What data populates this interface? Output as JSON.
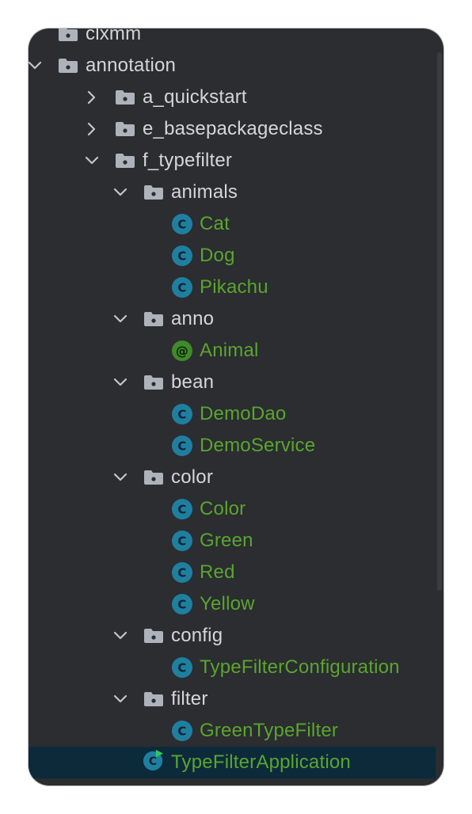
{
  "project_tree": {
    "items": [
      {
        "label": "clxmm",
        "kind": "package",
        "level": 0,
        "expanded": null
      },
      {
        "label": "annotation",
        "kind": "package",
        "level": 0,
        "expanded": true
      },
      {
        "label": "a_quickstart",
        "kind": "package",
        "level": 1,
        "expanded": false
      },
      {
        "label": "e_basepackageclass",
        "kind": "package",
        "level": 1,
        "expanded": false
      },
      {
        "label": "f_typefilter",
        "kind": "package",
        "level": 1,
        "expanded": true
      },
      {
        "label": "animals",
        "kind": "package",
        "level": 2,
        "expanded": true
      },
      {
        "label": "Cat",
        "kind": "class",
        "level": 3
      },
      {
        "label": "Dog",
        "kind": "class",
        "level": 3
      },
      {
        "label": "Pikachu",
        "kind": "class",
        "level": 3
      },
      {
        "label": "anno",
        "kind": "package",
        "level": 2,
        "expanded": true
      },
      {
        "label": "Animal",
        "kind": "annotation",
        "level": 3
      },
      {
        "label": "bean",
        "kind": "package",
        "level": 2,
        "expanded": true
      },
      {
        "label": "DemoDao",
        "kind": "class",
        "level": 3
      },
      {
        "label": "DemoService",
        "kind": "class",
        "level": 3
      },
      {
        "label": "color",
        "kind": "package",
        "level": 2,
        "expanded": true
      },
      {
        "label": "Color",
        "kind": "class",
        "level": 3
      },
      {
        "label": "Green",
        "kind": "class",
        "level": 3
      },
      {
        "label": "Red",
        "kind": "class",
        "level": 3
      },
      {
        "label": "Yellow",
        "kind": "class",
        "level": 3
      },
      {
        "label": "config",
        "kind": "package",
        "level": 2,
        "expanded": true
      },
      {
        "label": "TypeFilterConfiguration",
        "kind": "class",
        "level": 3
      },
      {
        "label": "filter",
        "kind": "package",
        "level": 2,
        "expanded": true
      },
      {
        "label": "GreenTypeFilter",
        "kind": "class",
        "level": 3
      },
      {
        "label": "TypeFilterApplication",
        "kind": "app-class",
        "level": 2,
        "selected": true
      }
    ]
  },
  "colors": {
    "background": "#2b2d30",
    "selection": "#0d2a3b",
    "folder_text": "#d4d6dc",
    "class_text": "#5aa52f",
    "class_icon": "#1f7fa0",
    "annotation_icon": "#3f8a2a",
    "run_badge": "#33c45a"
  }
}
